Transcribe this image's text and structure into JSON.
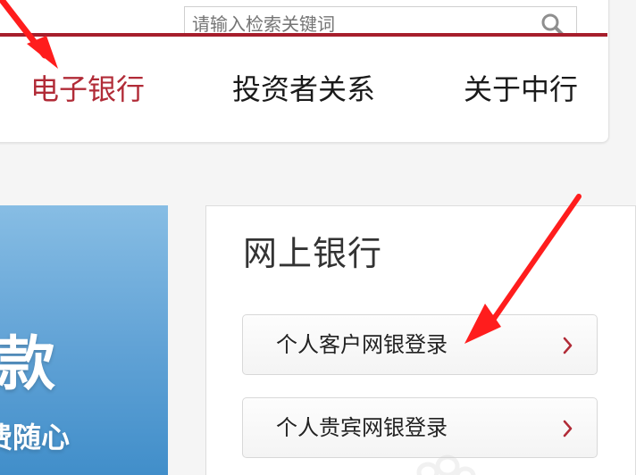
{
  "header": {
    "search": {
      "placeholder": "请输入检索关键词"
    },
    "nav": [
      {
        "label": "电子银行",
        "active": true
      },
      {
        "label": "投资者关系",
        "active": false
      },
      {
        "label": "关于中行",
        "active": false
      }
    ],
    "colors": {
      "brand": "#a61e2c",
      "active_text": "#b12b37",
      "annotation_arrow": "#ff1d1d"
    },
    "icons": {
      "search": "search-icon"
    }
  },
  "banner": {
    "title": "贷款",
    "subtitle": "费随心"
  },
  "online_banking": {
    "title": "网上银行",
    "buttons": [
      {
        "label": "个人客户网银登录",
        "icon": "chevron-right-icon"
      },
      {
        "label": "个人贵宾网银登录",
        "icon": "chevron-right-icon"
      }
    ],
    "decorations": {
      "paw": "paw-icon"
    }
  }
}
